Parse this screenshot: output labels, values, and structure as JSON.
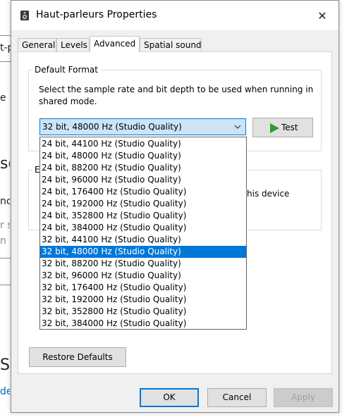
{
  "dialog": {
    "title": "Haut-parleurs Properties",
    "close_glyph": "✕"
  },
  "tabs": [
    {
      "label": "General"
    },
    {
      "label": "Levels"
    },
    {
      "label": "Advanced"
    },
    {
      "label": "Spatial sound"
    }
  ],
  "active_tab": "Advanced",
  "default_format": {
    "group_label": "Default Format",
    "description_line1": "Select the sample rate and bit depth to be used when running in",
    "description_line2": "shared mode.",
    "selected_value": "32 bit, 48000 Hz (Studio Quality)",
    "test_label": "Test"
  },
  "exclusive_group": {
    "label_fragment": "E",
    "text_fragment": "his device"
  },
  "dropdown_options": [
    "24 bit, 44100 Hz (Studio Quality)",
    "24 bit, 48000 Hz (Studio Quality)",
    "24 bit, 88200 Hz (Studio Quality)",
    "24 bit, 96000 Hz (Studio Quality)",
    "24 bit, 176400 Hz (Studio Quality)",
    "24 bit, 192000 Hz (Studio Quality)",
    "24 bit, 352800 Hz (Studio Quality)",
    "24 bit, 384000 Hz (Studio Quality)",
    "32 bit, 44100 Hz (Studio Quality)",
    "32 bit, 48000 Hz (Studio Quality)",
    "32 bit, 88200 Hz (Studio Quality)",
    "32 bit, 96000 Hz (Studio Quality)",
    "32 bit, 176400 Hz (Studio Quality)",
    "32 bit, 192000 Hz (Studio Quality)",
    "32 bit, 352800 Hz (Studio Quality)",
    "32 bit, 384000 Hz (Studio Quality)"
  ],
  "selected_index": 9,
  "buttons": {
    "restore_defaults": "Restore Defaults",
    "ok": "OK",
    "cancel": "Cancel",
    "apply": "Apply"
  },
  "background_fragments": {
    "frag1": "t-p",
    "frag2": "e",
    "frag3": "so",
    "frag4": "nc",
    "frag5": "r sp",
    "frag6": "n m",
    "frag7": "S",
    "frag8": "de"
  },
  "colors": {
    "accent": "#0078d7",
    "combo_bg": "#cce4f7",
    "play_green": "#2e9c2e",
    "dialog_bg": "#f0f0f0"
  }
}
